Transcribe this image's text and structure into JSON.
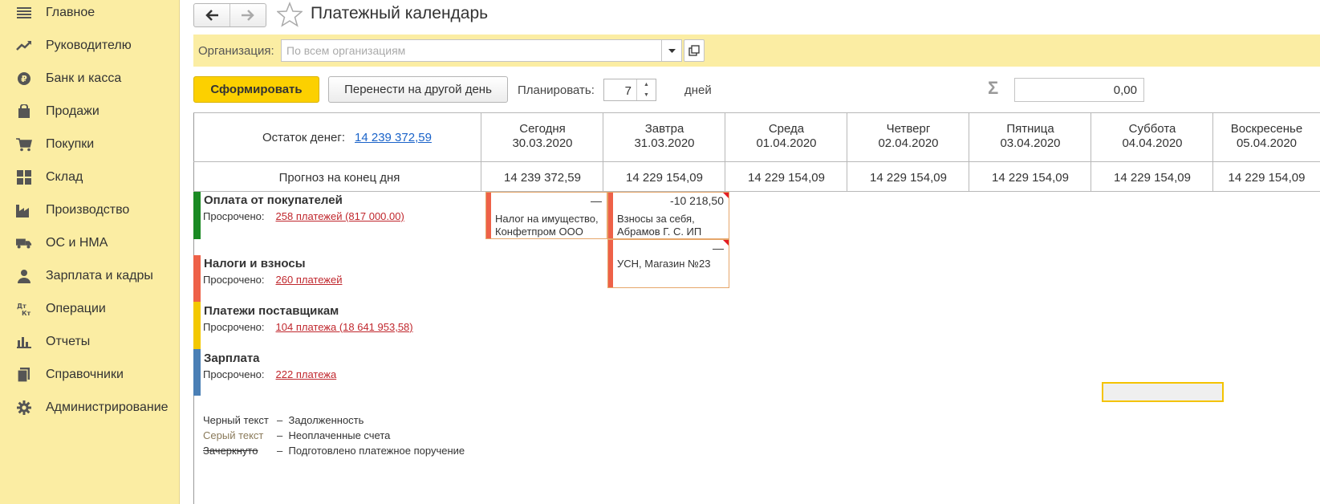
{
  "sidebar": {
    "items": [
      {
        "label": "Главное",
        "icon": "menu-lines-icon"
      },
      {
        "label": "Руководителю",
        "icon": "trend-up-icon"
      },
      {
        "label": "Банк и касса",
        "icon": "ruble-coin-icon"
      },
      {
        "label": "Продажи",
        "icon": "shopping-bag-icon"
      },
      {
        "label": "Покупки",
        "icon": "shopping-cart-icon"
      },
      {
        "label": "Склад",
        "icon": "warehouse-grid-icon"
      },
      {
        "label": "Производство",
        "icon": "factory-icon"
      },
      {
        "label": "ОС и НМА",
        "icon": "truck-icon"
      },
      {
        "label": "Зарплата и кадры",
        "icon": "person-icon"
      },
      {
        "label": "Операции",
        "icon": "dt-kt-icon"
      },
      {
        "label": "Отчеты",
        "icon": "bar-chart-icon"
      },
      {
        "label": "Справочники",
        "icon": "books-icon"
      },
      {
        "label": "Администрирование",
        "icon": "gear-icon"
      }
    ]
  },
  "header": {
    "title": "Платежный календарь"
  },
  "org": {
    "label": "Организация:",
    "placeholder": "По всем организациям"
  },
  "toolbar": {
    "generate_label": "Сформировать",
    "move_label": "Перенести на другой день",
    "plan_label": "Планировать:",
    "plan_days": "7",
    "days_label": "дней",
    "sigma": "Σ",
    "sum_value": "0,00"
  },
  "grid": {
    "balance_label": "Остаток денег:",
    "balance_value": "14 239 372,59",
    "forecast_label": "Прогноз на конец дня",
    "days": [
      {
        "name": "Сегодня",
        "date": "30.03.2020",
        "forecast": "14 239 372,59"
      },
      {
        "name": "Завтра",
        "date": "31.03.2020",
        "forecast": "14 229 154,09"
      },
      {
        "name": "Среда",
        "date": "01.04.2020",
        "forecast": "14 229 154,09"
      },
      {
        "name": "Четверг",
        "date": "02.04.2020",
        "forecast": "14 229 154,09"
      },
      {
        "name": "Пятница",
        "date": "03.04.2020",
        "forecast": "14 229 154,09"
      },
      {
        "name": "Суббота",
        "date": "04.04.2020",
        "forecast": "14 229 154,09"
      },
      {
        "name": "Воскресенье",
        "date": "05.04.2020",
        "forecast": "14 229 154,09"
      }
    ],
    "categories": [
      {
        "title": "Оплата от покупателей",
        "overdue_label": "Просрочено:",
        "overdue_link": "258 платежей (817 000.00)",
        "color": "#1a8a23"
      },
      {
        "title": "Налоги и взносы",
        "overdue_label": "Просрочено:",
        "overdue_link": "260 платежей",
        "color": "#ee6148"
      },
      {
        "title": "Платежи поставщикам",
        "overdue_label": "Просрочено:",
        "overdue_link": "104 платежа (18 641 953,58)",
        "color": "#f3c800"
      },
      {
        "title": "Зарплата",
        "overdue_label": "Просрочено:",
        "overdue_link": "222 платежа",
        "color": "#4a7fb5"
      }
    ],
    "cards": [
      {
        "amount": "—",
        "line1": "Налог на имущество,",
        "line2": "Конфетпром ООО"
      },
      {
        "amount": "-10 218,50",
        "line1": "Взносы за себя,",
        "line2": "Абрамов Г. С. ИП"
      },
      {
        "amount": "—",
        "line1": "УСН, Магазин №23",
        "line2": ""
      }
    ]
  },
  "legend": [
    {
      "key": "Черный текст",
      "sep": "–",
      "desc": "Задолженность",
      "color": "#333333",
      "strike": false
    },
    {
      "key": "Серый текст",
      "sep": "–",
      "desc": "Неоплаченные счета",
      "color": "#8a7a5a",
      "strike": false
    },
    {
      "key": "Зачеркнуто",
      "sep": "–",
      "desc": "Подготовлено платежное поручение",
      "color": "#333333",
      "strike": true
    }
  ],
  "colors": {
    "sidebar_bg": "#fbeda3",
    "primary": "#fcd000",
    "link": "#1a63c9",
    "overdue_link": "#c0272d"
  }
}
